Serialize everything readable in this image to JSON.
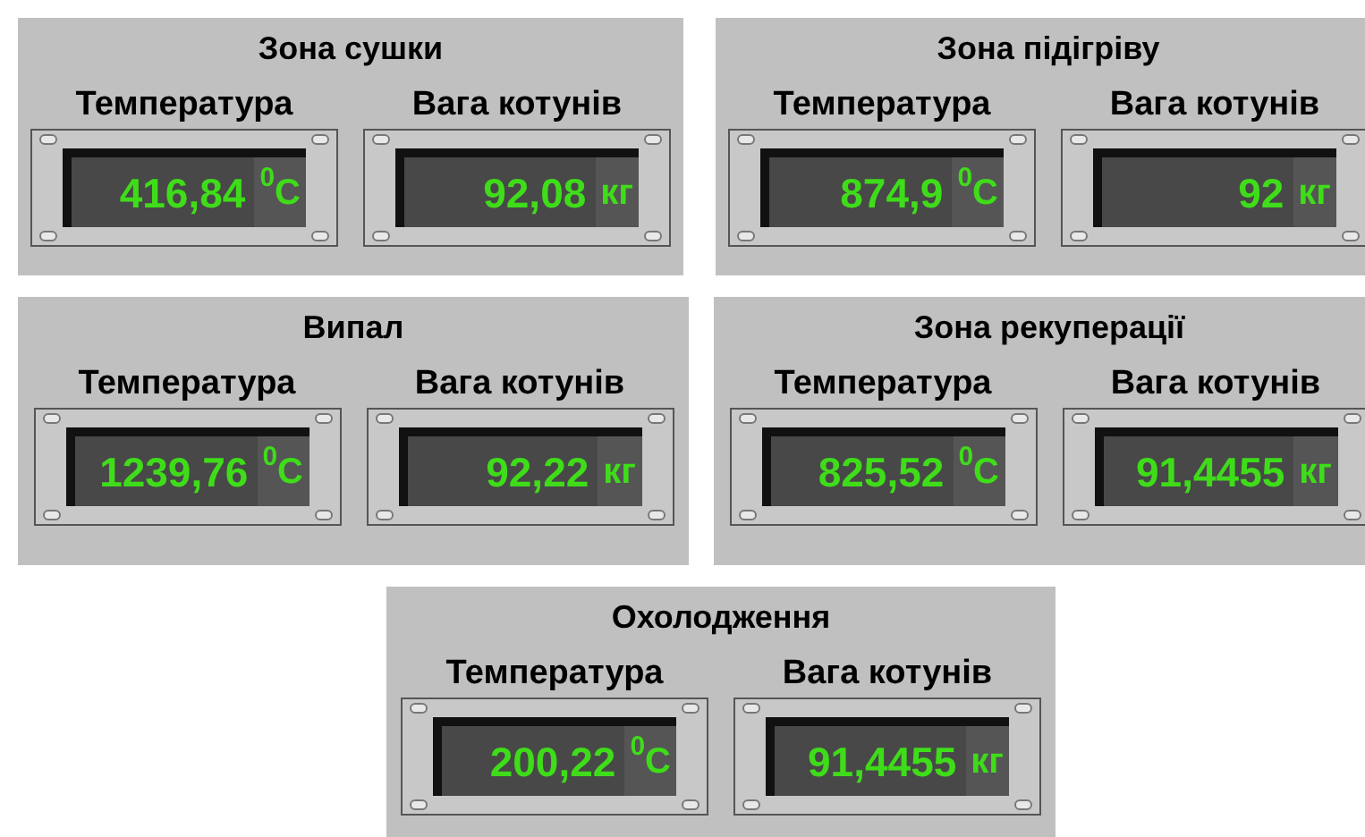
{
  "zones": [
    {
      "title": "Зона сушки",
      "readings": [
        {
          "label": "Температура",
          "value": "416,84",
          "unit": "$^{0}$C"
        },
        {
          "label": "Вага котунів",
          "value": "92,08",
          "unit": "кг"
        }
      ]
    },
    {
      "title": "Зона підігріву",
      "readings": [
        {
          "label": "Температура",
          "value": "874,9",
          "unit": "$^{0}$C"
        },
        {
          "label": "Вага котунів",
          "value": "92",
          "unit": "кг"
        }
      ]
    },
    {
      "title": "Випал",
      "readings": [
        {
          "label": "Температура",
          "value": "1239,76",
          "unit": "$^{0}$C"
        },
        {
          "label": "Вага котунів",
          "value": "92,22",
          "unit": "кг"
        }
      ]
    },
    {
      "title": "Зона рекуперації",
      "readings": [
        {
          "label": "Температура",
          "value": "825,52",
          "unit": "$^{0}$C"
        },
        {
          "label": "Вага котунів",
          "value": "91,4455",
          "unit": "кг"
        }
      ]
    },
    {
      "title": "Охолодження",
      "readings": [
        {
          "label": "Температура",
          "value": "200,22",
          "unit": "$^{0}$C"
        },
        {
          "label": "Вага котунів",
          "value": "91,4455",
          "unit": "кг"
        }
      ]
    }
  ]
}
